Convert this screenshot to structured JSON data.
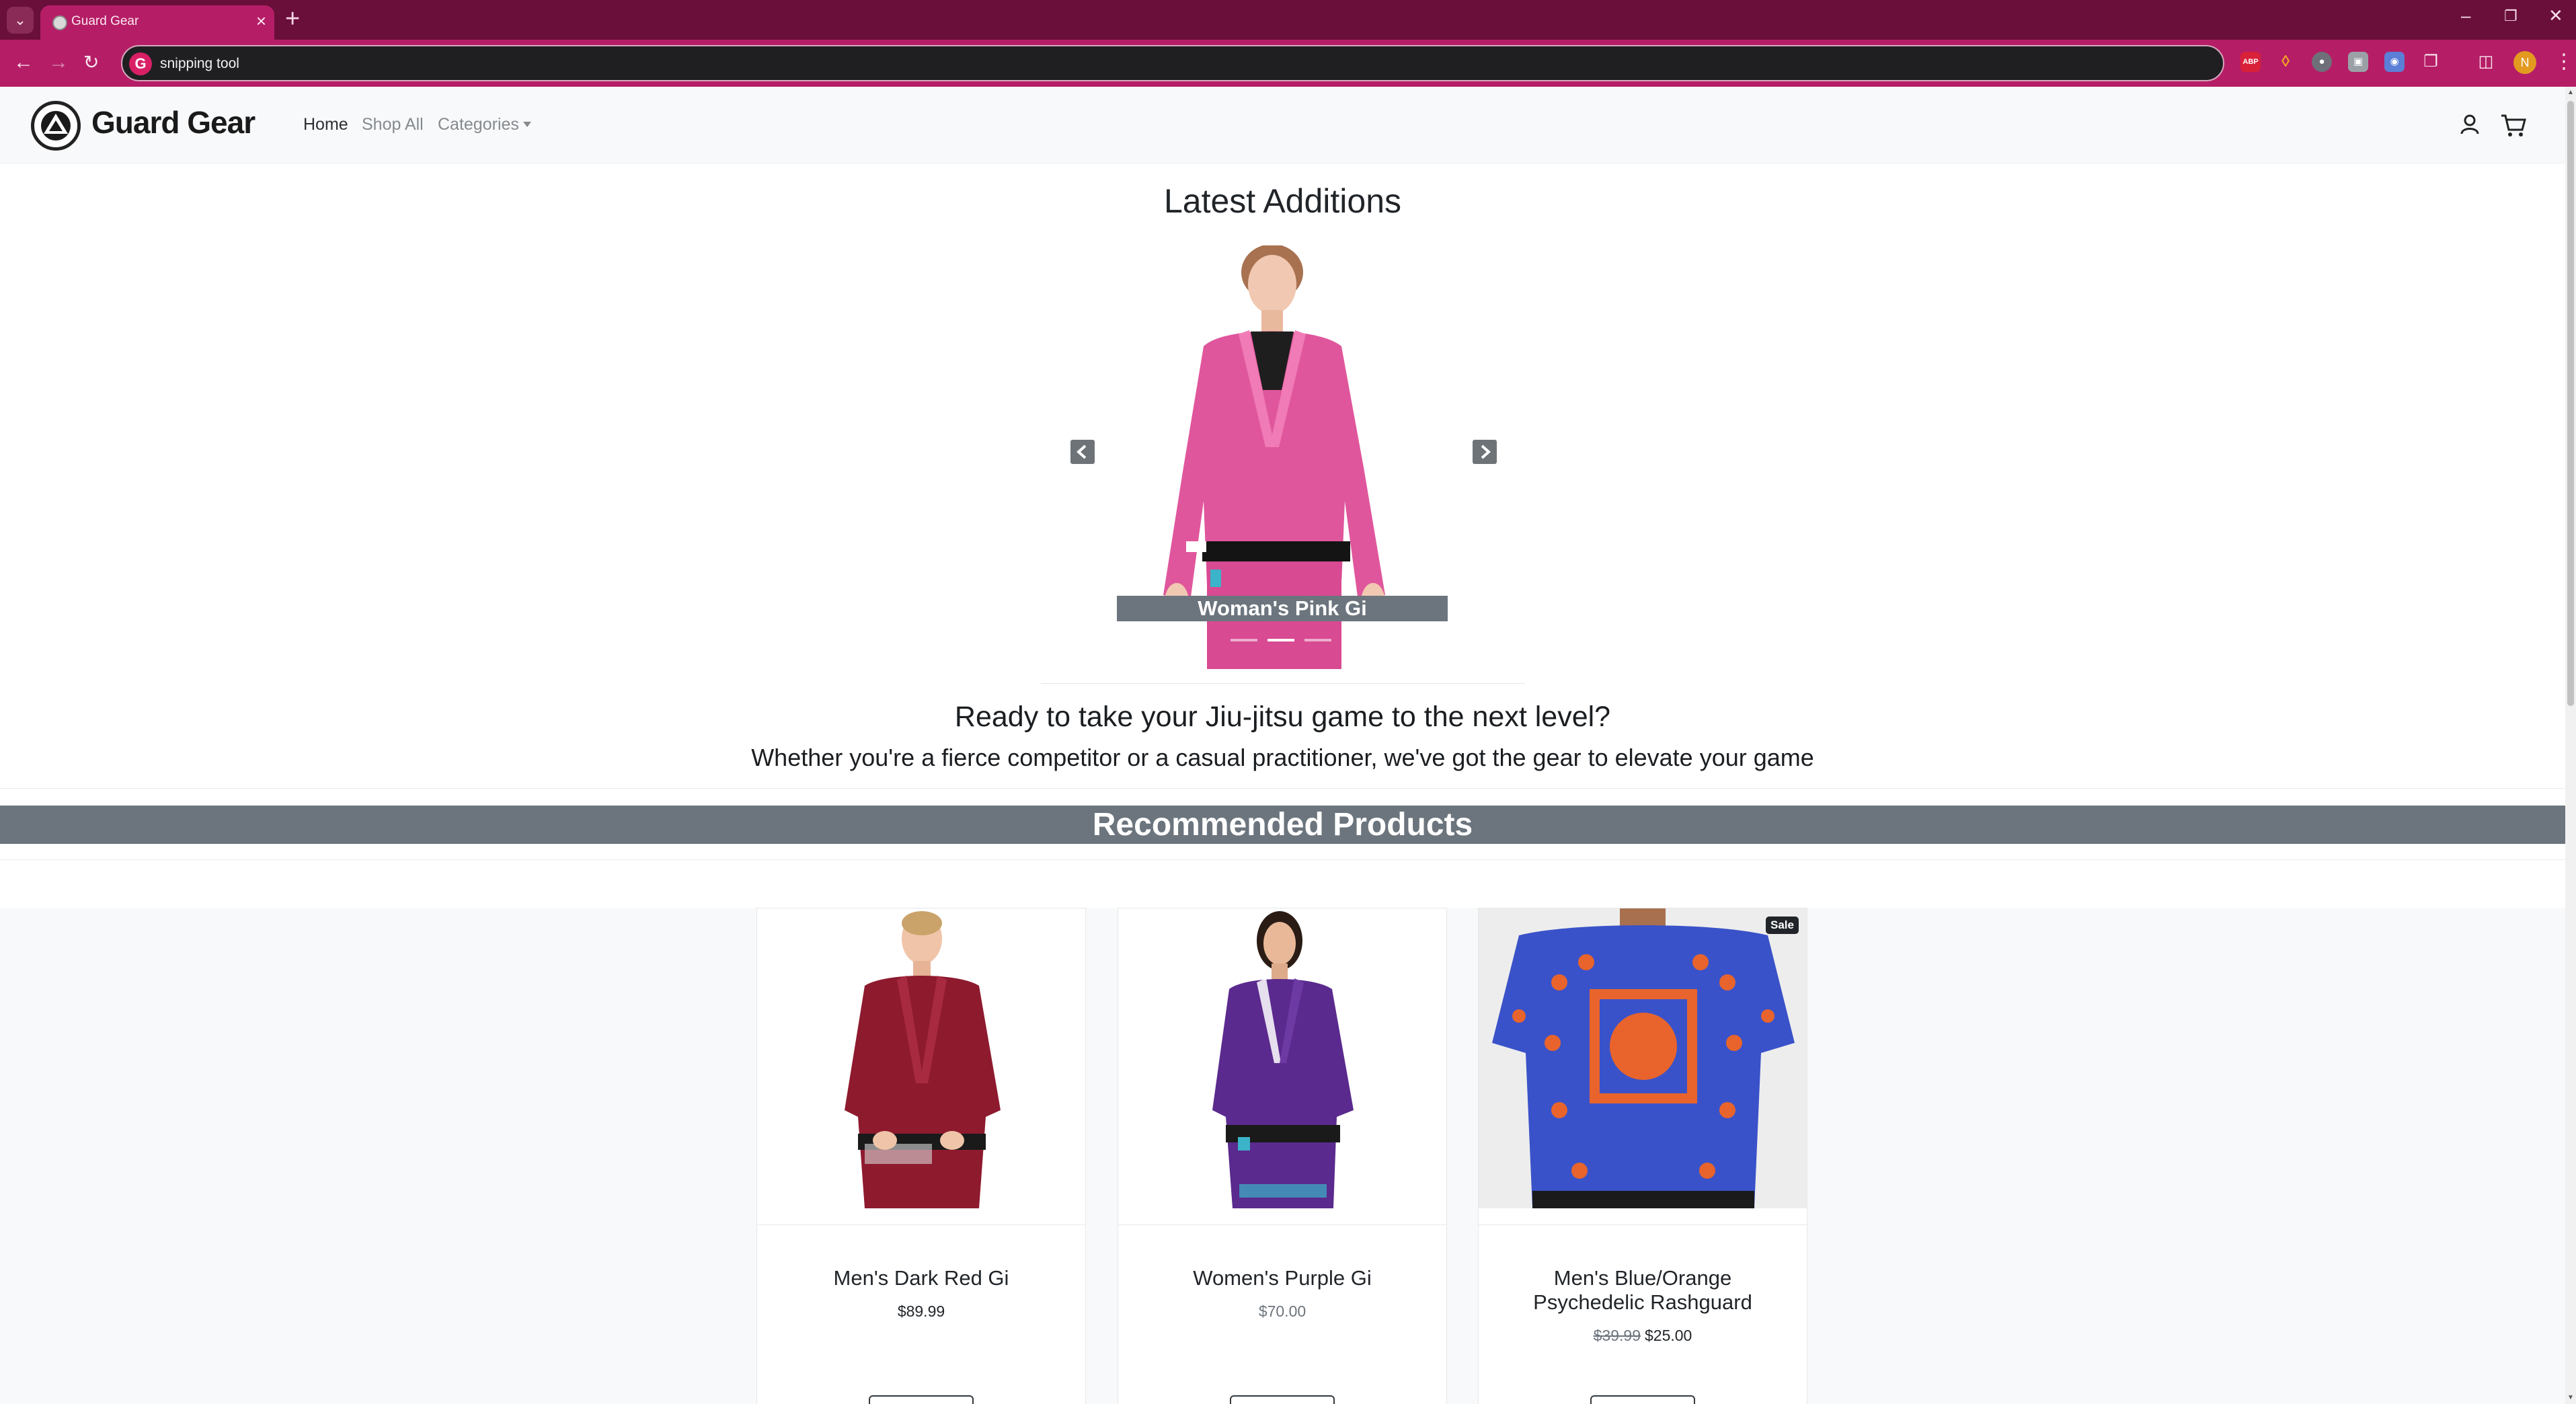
{
  "browser": {
    "tab_title": "Guard Gear",
    "address_text": "snipping tool",
    "profile_initial": "N",
    "extensions": [
      "abp-icon",
      "diamond-icon",
      "copilot-icon",
      "page-icon",
      "camera-icon",
      "puzzle-icon"
    ]
  },
  "site": {
    "brand": "Guard Gear",
    "nav": {
      "home": "Home",
      "shop_all": "Shop All",
      "categories": "Categories"
    }
  },
  "carousel": {
    "title": "Latest Additions",
    "caption": "Woman's Pink Gi",
    "slide_count": 3,
    "active_index": 1
  },
  "hero": {
    "heading": "Ready to take your Jiu-jitsu game to the next level?",
    "subheading": "Whether you're a fierce competitor or a casual practitioner, we've got the gear to elevate your game"
  },
  "recommended": {
    "title": "Recommended Products",
    "products": [
      {
        "title": "Men's Dark Red Gi",
        "price": "$89.99",
        "old_price": "",
        "sale": "",
        "color": "#8e1a2e"
      },
      {
        "title": "Women's Purple Gi",
        "price": "$70.00",
        "old_price": "",
        "sale": "",
        "color": "#5a2a8e"
      },
      {
        "title_line1": "Men's Blue/Orange",
        "title_line2": "Psychedelic Rashguard",
        "price": "$25.00",
        "old_price": "$39.99",
        "sale": "Sale",
        "color": "#3a52c9"
      }
    ]
  },
  "colors": {
    "tab_bg": "#6a0f3a",
    "toolbar_bg": "#b51e66",
    "caption_bg": "#6c757d",
    "navbar_bg": "#f8f9fa"
  }
}
